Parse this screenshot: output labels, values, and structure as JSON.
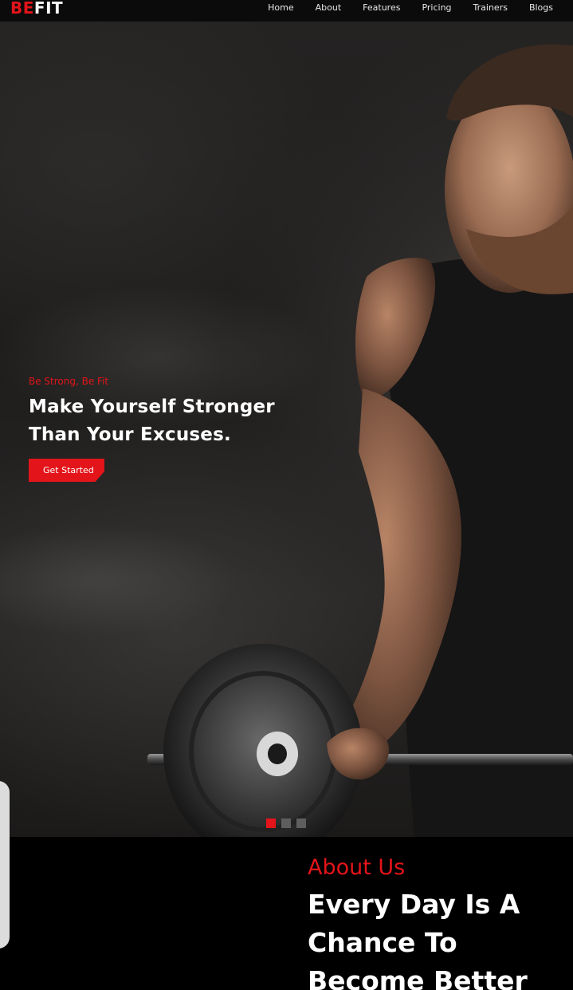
{
  "brand": {
    "logo_part_a": "BE",
    "logo_part_b": "FIT"
  },
  "nav": {
    "items": [
      {
        "label": "Home"
      },
      {
        "label": "About"
      },
      {
        "label": "Features"
      },
      {
        "label": "Pricing"
      },
      {
        "label": "Trainers"
      },
      {
        "label": "Blogs"
      }
    ]
  },
  "hero": {
    "tagline": "Be Strong, Be Fit",
    "title": "Make Yourself Stronger Than Your Excuses.",
    "cta_label": "Get Started",
    "slides_total": 3,
    "active_slide": 1
  },
  "about": {
    "label": "About Us",
    "heading": "Every Day Is A Chance To Become Better"
  },
  "colors": {
    "accent": "#e3141a",
    "background": "#000000",
    "text": "#ffffff"
  }
}
